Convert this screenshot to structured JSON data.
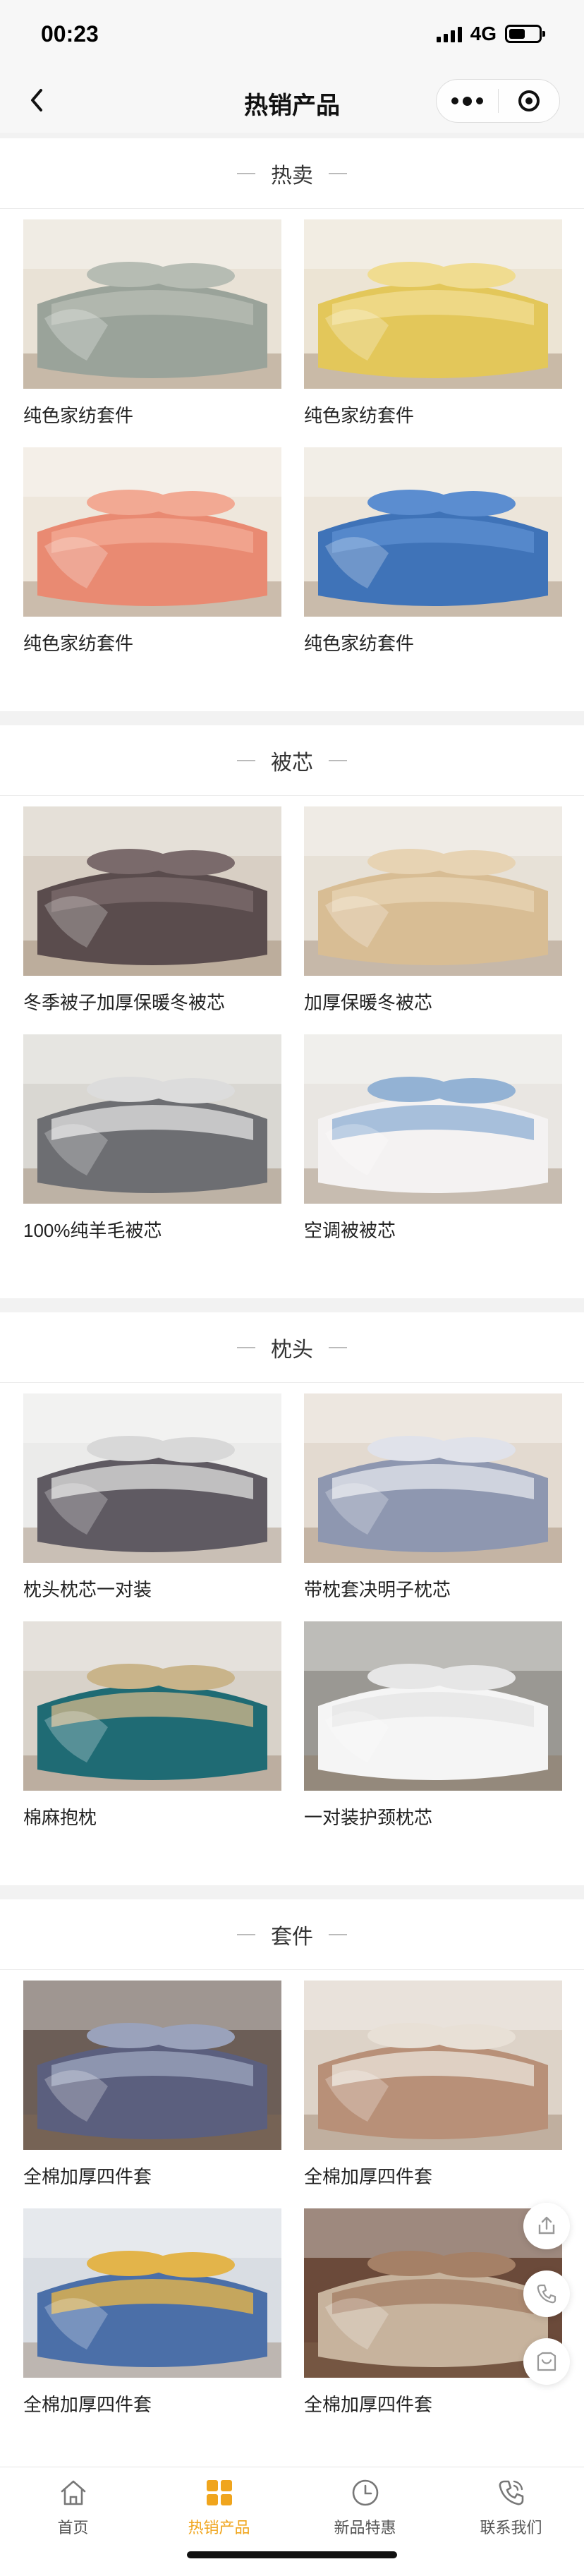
{
  "status_bar": {
    "time": "00:23",
    "network": "4G",
    "battery_level": 0.5
  },
  "nav": {
    "title": "热销产品"
  },
  "sections": [
    {
      "title": "热卖",
      "products": [
        {
          "name": "纯色家纺套件",
          "colors": [
            "#e9e2d6",
            "#9aa39a",
            "#b6bcb3"
          ]
        },
        {
          "name": "纯色家纺套件",
          "colors": [
            "#ece4d4",
            "#e3c75a",
            "#f0dc90"
          ]
        },
        {
          "name": "纯色家纺套件",
          "colors": [
            "#eee7dc",
            "#e98a72",
            "#f2a993"
          ]
        },
        {
          "name": "纯色家纺套件",
          "colors": [
            "#ece5da",
            "#3f73b8",
            "#5b8dd0"
          ]
        }
      ]
    },
    {
      "title": "被芯",
      "products": [
        {
          "name": "冬季被子加厚保暖冬被芯",
          "colors": [
            "#d8cfc4",
            "#5a4c4d",
            "#7a6a6b"
          ]
        },
        {
          "name": "加厚保暖冬被芯",
          "colors": [
            "#e7e1d7",
            "#d8bd94",
            "#e7d3b3"
          ]
        },
        {
          "name": "100%纯羊毛被芯",
          "colors": [
            "#d9d7d2",
            "#6d6e72",
            "#dcdcdc"
          ]
        },
        {
          "name": "空调被被芯",
          "colors": [
            "#e9e6e2",
            "#f4f2f2",
            "#93b2d4"
          ]
        }
      ]
    },
    {
      "title": "枕头",
      "products": [
        {
          "name": "枕头枕芯一对装",
          "colors": [
            "#ebebea",
            "#5f5a62",
            "#d8d8d8"
          ]
        },
        {
          "name": "带枕套决明子枕芯",
          "colors": [
            "#e3dad0",
            "#8e97b0",
            "#e0e2ea"
          ]
        },
        {
          "name": "棉麻抱枕",
          "colors": [
            "#d8d2c9",
            "#1f6b74",
            "#c9b48a"
          ]
        },
        {
          "name": "一对装护颈枕芯",
          "colors": [
            "#9a9893",
            "#f5f5f5",
            "#e6e6e6"
          ]
        }
      ]
    },
    {
      "title": "套件",
      "products": [
        {
          "name": "全棉加厚四件套",
          "colors": [
            "#6c5e57",
            "#5b5f7e",
            "#9aa2bb"
          ]
        },
        {
          "name": "全棉加厚四件套",
          "colors": [
            "#ddd3c8",
            "#b89078",
            "#e8e0d6"
          ]
        },
        {
          "name": "全棉加厚四件套",
          "colors": [
            "#d9dde3",
            "#4b6fa8",
            "#e3b44a"
          ]
        },
        {
          "name": "全棉加厚四件套",
          "colors": [
            "#6b4a3a",
            "#c7b39d",
            "#a58066"
          ]
        }
      ]
    }
  ],
  "float_buttons": [
    {
      "icon": "share-icon"
    },
    {
      "icon": "phone-icon"
    },
    {
      "icon": "store-icon"
    }
  ],
  "tabs": [
    {
      "label": "首页",
      "icon": "home-icon",
      "active": false
    },
    {
      "label": "热销产品",
      "icon": "grid-icon",
      "active": true
    },
    {
      "label": "新品特惠",
      "icon": "clock-icon",
      "active": false
    },
    {
      "label": "联系我们",
      "icon": "phone-icon",
      "active": false
    }
  ],
  "accent_color": "#f0a51d"
}
